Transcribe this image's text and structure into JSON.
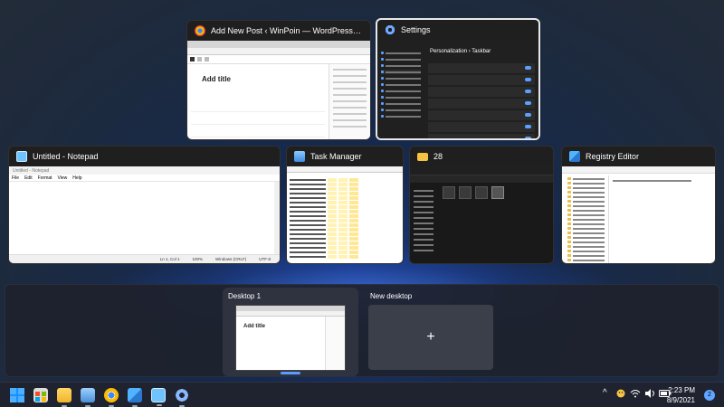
{
  "windows": [
    {
      "title": "Add New Post ‹ WinPoin — WordPress - Google...",
      "app_icon": "chrome-icon",
      "content": {
        "heading": "Add title"
      }
    },
    {
      "title": "Settings",
      "app_icon": "settings-gear-icon",
      "content": {
        "heading": "Personalization › Taskbar"
      }
    },
    {
      "title": "Untitled - Notepad",
      "app_icon": "notepad-icon",
      "content": {
        "caption": "Untitled - Notepad",
        "menu": [
          "File",
          "Edit",
          "Format",
          "View",
          "Help"
        ],
        "status": [
          "Ln 1, Col 1",
          "100%",
          "Windows (CRLF)",
          "UTF-8"
        ]
      }
    },
    {
      "title": "Task Manager",
      "app_icon": "task-manager-icon"
    },
    {
      "title": "28",
      "app_icon": "folder-icon"
    },
    {
      "title": "Registry Editor",
      "app_icon": "registry-editor-icon"
    }
  ],
  "desktops": {
    "items": [
      {
        "label": "Desktop 1",
        "thumb_heading": "Add title"
      }
    ],
    "new_label": "New desktop",
    "add_symbol": "+"
  },
  "taskbar": {
    "apps": [
      "windows-start-icon",
      "microsoft-store-icon",
      "file-explorer-icon",
      "photos-icon",
      "chrome-icon",
      "registry-editor-icon",
      "notepad-icon",
      "settings-gear-icon"
    ],
    "tray": {
      "chevron": "^",
      "time": "2:23 PM",
      "date": "8/9/2021",
      "notifications": "2"
    }
  },
  "colors": {
    "accent": "#60a5ff",
    "taskbar": "#1f2330"
  }
}
